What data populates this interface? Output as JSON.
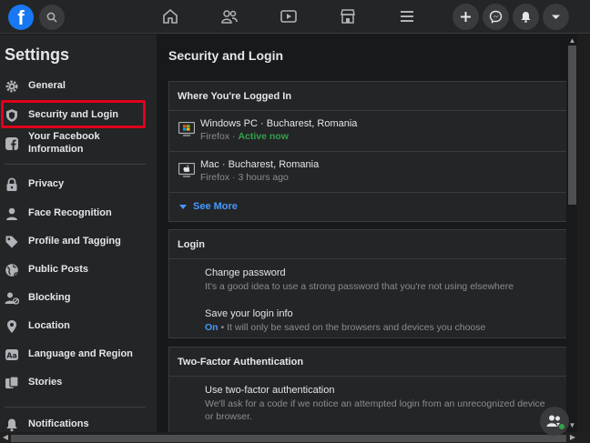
{
  "topbar": {
    "logo_letter": "f",
    "nav_icons": [
      "home-icon",
      "friends-icon",
      "watch-icon",
      "marketplace-icon",
      "menu-icon"
    ],
    "right_buttons": [
      "create-icon",
      "messenger-icon",
      "notifications-icon",
      "account-menu-icon"
    ]
  },
  "sidebar": {
    "title": "Settings",
    "items": [
      {
        "label": "General",
        "icon": "gear-icon"
      },
      {
        "label": "Security and Login",
        "icon": "shield-icon",
        "active": true
      },
      {
        "label": "Your Facebook Information",
        "icon": "facebook-icon"
      },
      {
        "label": "Privacy",
        "icon": "lock-icon"
      },
      {
        "label": "Face Recognition",
        "icon": "face-icon"
      },
      {
        "label": "Profile and Tagging",
        "icon": "tag-icon"
      },
      {
        "label": "Public Posts",
        "icon": "globe-icon"
      },
      {
        "label": "Blocking",
        "icon": "block-user-icon"
      },
      {
        "label": "Location",
        "icon": "location-pin-icon"
      },
      {
        "label": "Language and Region",
        "icon": "language-icon"
      },
      {
        "label": "Stories",
        "icon": "stories-icon"
      },
      {
        "label": "Notifications",
        "icon": "bell-icon"
      }
    ],
    "highlight_color": "#e0001b"
  },
  "main": {
    "title": "Security and Login",
    "logged_in": {
      "header": "Where You're Logged In",
      "sessions": [
        {
          "device": "Windows PC",
          "location": "Bucharest, Romania",
          "browser": "Firefox",
          "status": "Active now",
          "icon": "windows-icon"
        },
        {
          "device": "Mac",
          "location": "Bucharest, Romania",
          "browser": "Firefox",
          "status": "3 hours ago",
          "icon": "apple-icon"
        }
      ],
      "separator": " · ",
      "see_more": "See More"
    },
    "login": {
      "header": "Login",
      "options": [
        {
          "title": "Change password",
          "desc": "It's a good idea to use a strong password that you're not using elsewhere"
        },
        {
          "title": "Save your login info",
          "on": "On",
          "desc": " • It will only be saved on the browsers and devices you choose"
        }
      ]
    },
    "two_factor": {
      "header": "Two-Factor Authentication",
      "options": [
        {
          "title": "Use two-factor authentication",
          "desc": "We'll ask for a code if we notice an attempted login from an unrecognized device or browser."
        }
      ]
    }
  },
  "colors": {
    "accent_blue": "#4599ff",
    "active_green": "#31a24c",
    "brand": "#1877f2"
  }
}
